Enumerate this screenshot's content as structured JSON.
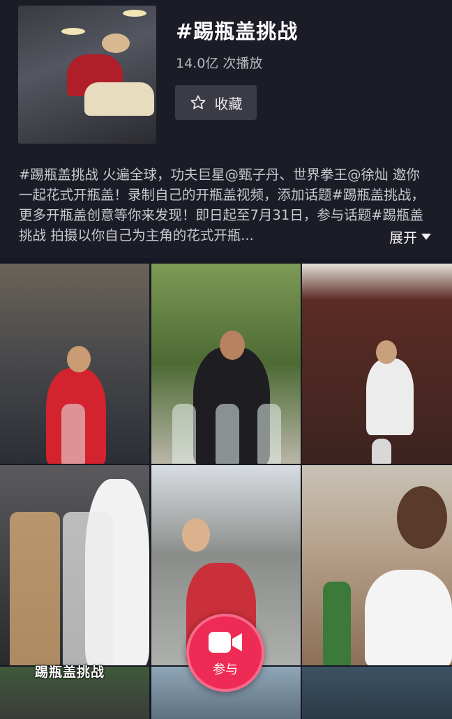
{
  "topic": {
    "title": "#踢瓶盖挑战",
    "views": "14.0亿 次播放",
    "favorite_label": "收藏",
    "description": "#踢瓶盖挑战 火遍全球，功夫巨星@甄子丹、世界拳王@徐灿 邀你一起花式开瓶盖！录制自己的开瓶盖视频，添加话题#踢瓶盖挑战，更多开瓶盖创意等你来发现！即日起至7月31日，参与话题#踢瓶盖挑战 拍摄以你自己为主角的花式开瓶...",
    "expand_label": "展开"
  },
  "videos": [
    {
      "thumb": "gym-man-red-shirt-bottle"
    },
    {
      "thumb": "man-black-tank-three-bottles"
    },
    {
      "thumb": "man-white-shirt-door"
    },
    {
      "thumb": "two-tea-bottles"
    },
    {
      "thumb": "man-red-white-jacket-yard"
    },
    {
      "thumb": "bald-man-green-bottle"
    },
    {
      "thumb": "outdoor-trees"
    },
    {
      "thumb": "poster-wall"
    },
    {
      "thumb": "store-banners"
    }
  ],
  "overlay_caption": "踢瓶盖挑战",
  "join_button": {
    "label": "参与",
    "color": "#ee2b55",
    "icon": "video-camera-icon"
  },
  "icons": {
    "favorite": "star-outline-icon",
    "expand": "triangle-down-icon"
  },
  "colors": {
    "background": "#161823",
    "header": "#1b1c26",
    "accent": "#ee2b55"
  }
}
